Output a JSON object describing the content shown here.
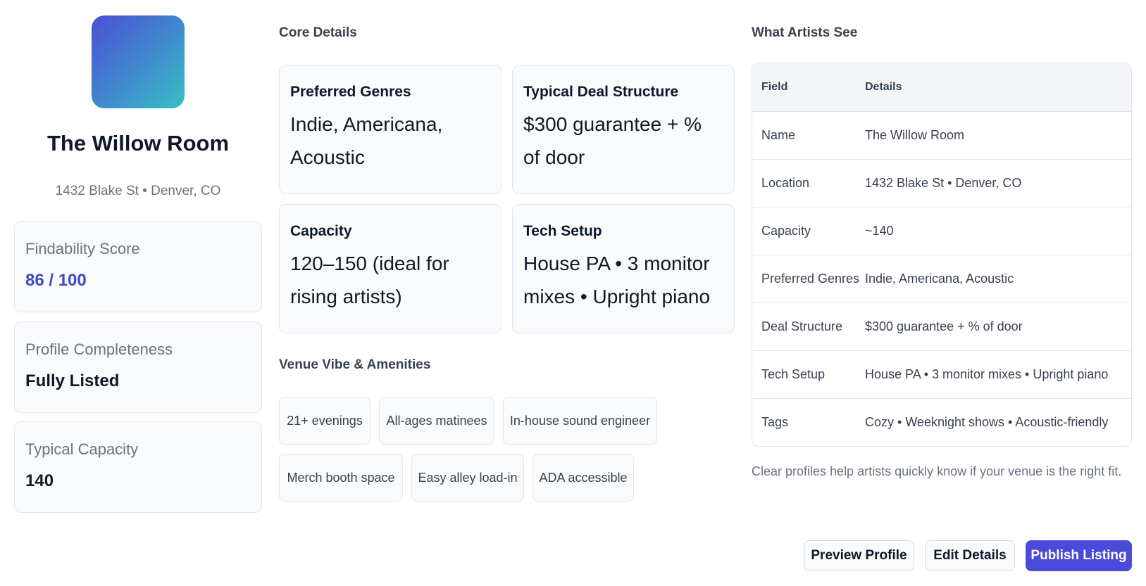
{
  "venue": {
    "name": "The Willow Room",
    "address": "1432 Blake St • Denver, CO"
  },
  "stats": [
    {
      "label": "Findability Score",
      "value": "86 / 100"
    },
    {
      "label": "Profile Completeness",
      "value": "Fully Listed"
    },
    {
      "label": "Typical Capacity",
      "value": "140"
    }
  ],
  "core": {
    "title": "Core Details",
    "cards": [
      {
        "title": "Preferred Genres",
        "value": "Indie, Americana, Acoustic"
      },
      {
        "title": "Typical Deal Structure",
        "value": "$300 guarantee + % of door"
      },
      {
        "title": "Capacity",
        "value": "120–150 (ideal for rising artists)"
      },
      {
        "title": "Tech Setup",
        "value": "House PA • 3 monitor mixes • Upright piano"
      }
    ]
  },
  "vibe": {
    "title": "Venue Vibe & Amenities",
    "tags": [
      "21+ evenings",
      "All-ages matinees",
      "In-house sound engineer",
      "Merch booth space",
      "Easy alley load-in",
      "ADA accessible"
    ]
  },
  "artist_view": {
    "title": "What Artists See",
    "headers": [
      "Field",
      "Details"
    ],
    "rows": [
      [
        "Name",
        "The Willow Room"
      ],
      [
        "Location",
        "1432 Blake St • Denver, CO"
      ],
      [
        "Capacity",
        "~140"
      ],
      [
        "Preferred Genres",
        "Indie, Americana, Acoustic"
      ],
      [
        "Deal Structure",
        "$300 guarantee + % of door"
      ],
      [
        "Tech Setup",
        "House PA • 3 monitor mixes • Upright piano"
      ],
      [
        "Tags",
        "Cozy • Weeknight shows • Acoustic-friendly"
      ]
    ],
    "note": "Clear profiles help artists quickly know if your venue is the right fit."
  },
  "actions": {
    "preview": "Preview Profile",
    "edit": "Edit Details",
    "publish": "Publish Listing"
  },
  "colors": {
    "accent": "#4a4bd8",
    "score": "#4348c4"
  }
}
